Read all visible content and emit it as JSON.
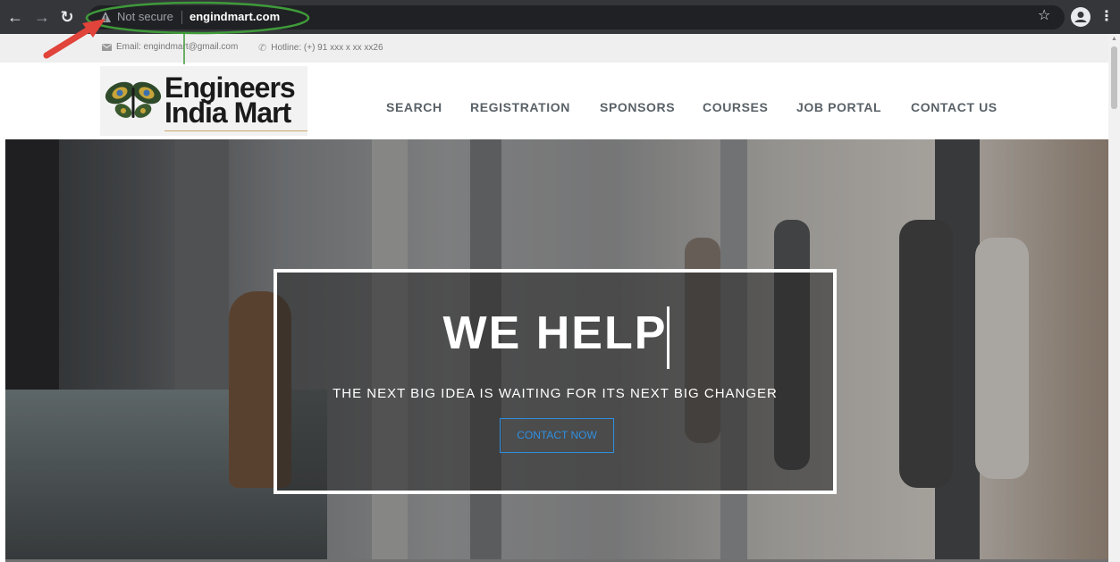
{
  "browser": {
    "security_label": "Not secure",
    "url": "engindmart.com"
  },
  "topbar": {
    "email": "Email: engindmart@gmail.com",
    "hotline": "Hotline: (+) 91 xxx x xx xx26"
  },
  "logo": {
    "line1": "Engineers",
    "line2": "India Mart"
  },
  "nav": {
    "items": [
      "SEARCH",
      "REGISTRATION",
      "SPONSORS",
      "COURSES",
      "JOB PORTAL",
      "CONTACT US"
    ]
  },
  "hero": {
    "title": "WE HELP",
    "subtitle": "THE NEXT BIG IDEA IS WAITING FOR ITS NEXT BIG CHANGER",
    "cta": "CONTACT NOW"
  },
  "colors": {
    "chrome_bg": "#35363a",
    "omnibox_bg": "#202124",
    "annotation_green": "#3f9a3a",
    "annotation_arrow": "#e0443a",
    "cta_blue": "#2f8fe0",
    "nav_text": "#5a6268"
  }
}
